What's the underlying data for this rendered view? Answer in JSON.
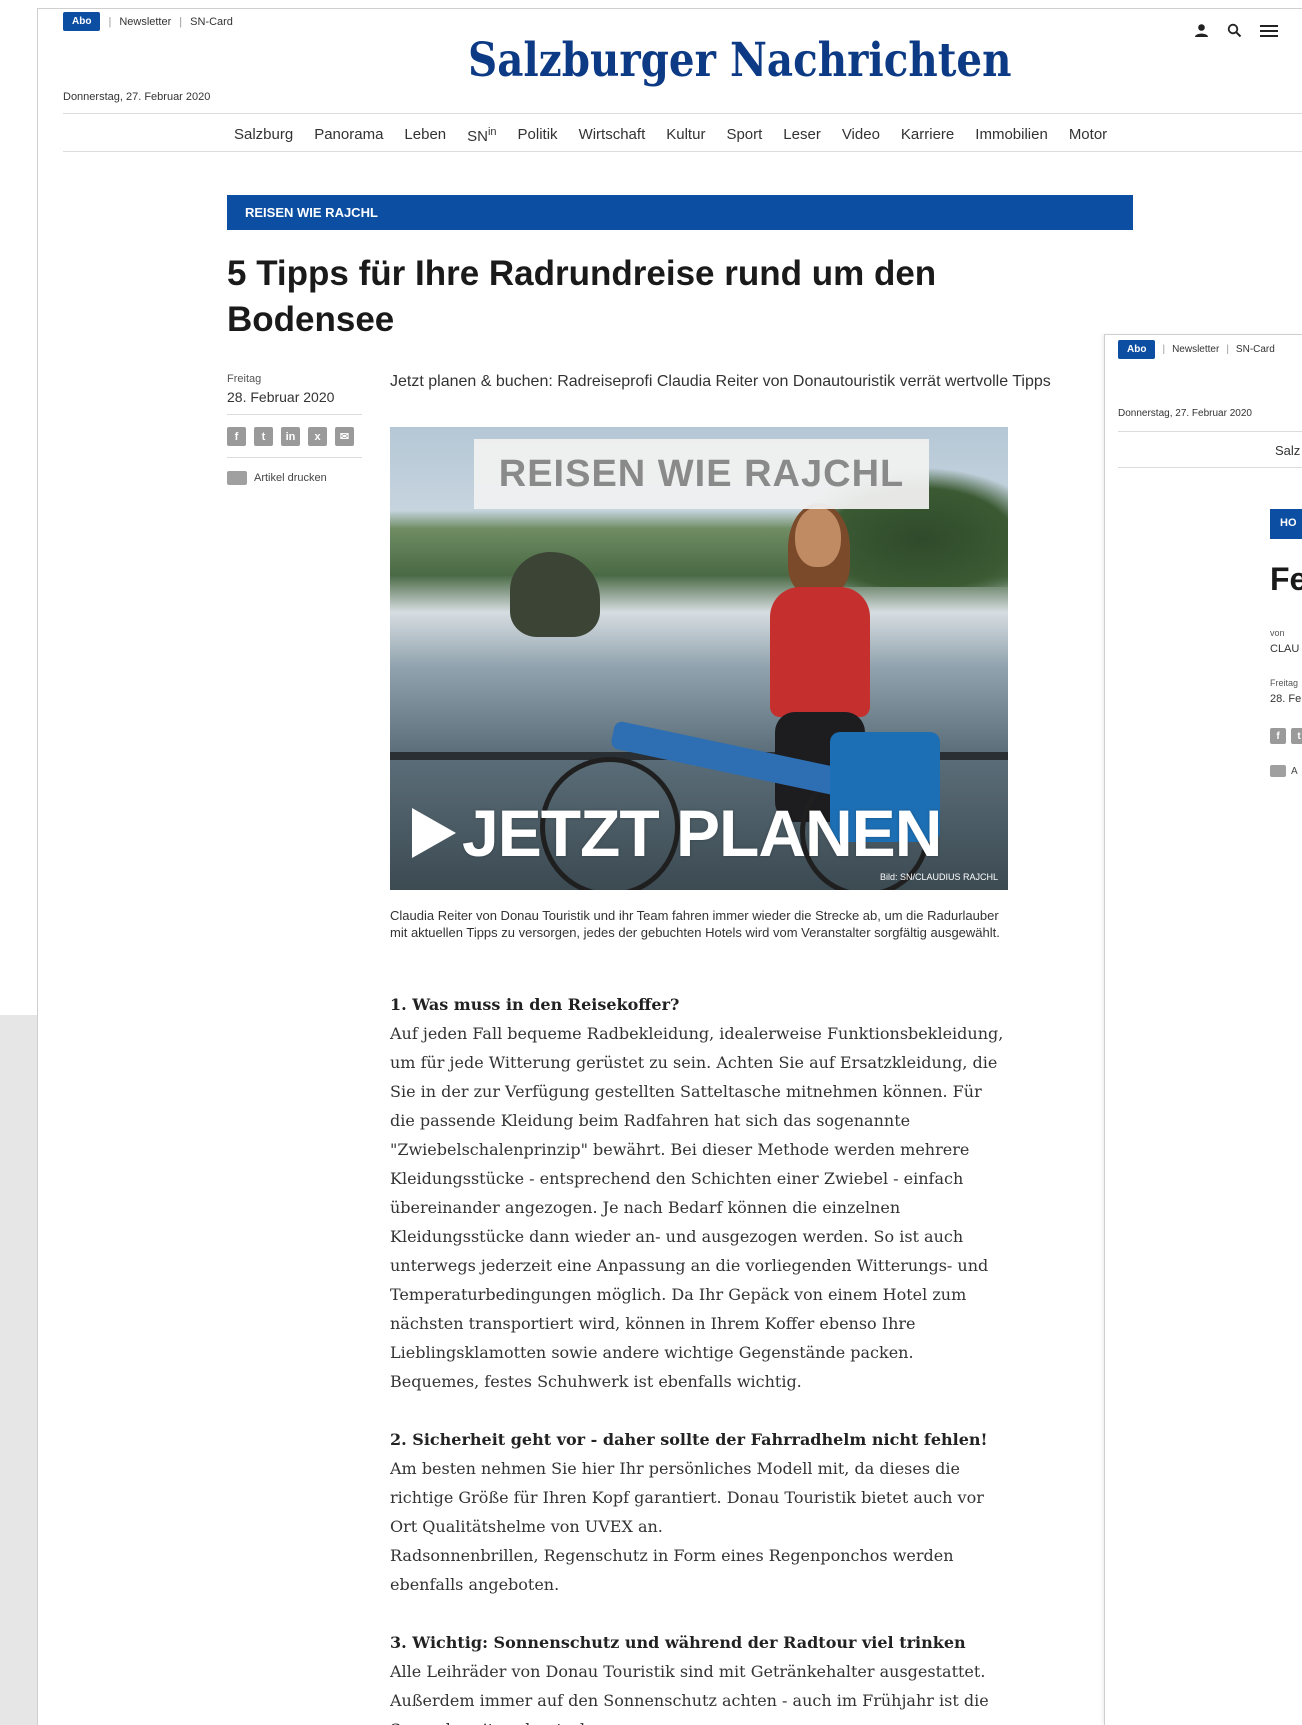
{
  "topbar": {
    "abo": "Abo",
    "newsletter": "Newsletter",
    "sncard": "SN-Card",
    "sep": "|"
  },
  "header": {
    "date": "Donnerstag, 27. Februar 2020",
    "logo": "Salzburger Nachrichten"
  },
  "nav": {
    "items": [
      "Salzburg",
      "Panorama",
      "Leben",
      "SN",
      "Politik",
      "Wirtschaft",
      "Kultur",
      "Sport",
      "Leser",
      "Video",
      "Karriere",
      "Immobilien",
      "Motor"
    ],
    "sn_sup": "in"
  },
  "article": {
    "kicker": "REISEN WIE RAJCHL",
    "headline": "5 Tipps für Ihre Radrundreise rund um den Bodensee",
    "meta_day": "Freitag",
    "meta_date": "28. Februar 2020",
    "share": [
      "f",
      "t",
      "in",
      "x",
      "✉"
    ],
    "print_label": "Artikel drucken",
    "lead": "Jetzt planen & buchen: Radreiseprofi Claudia Reiter von Donautouristik verrät wertvolle Tipps",
    "image": {
      "banner": "REISEN WIE RAJCHL",
      "cta": "JETZT PLANEN",
      "credit": "Bild: SN/CLAUDIUS RAJCHL"
    },
    "caption": "Claudia Reiter von Donau Touristik und ihr Team fahren immer wieder die Strecke ab, um die Radurlauber mit aktuellen Tipps zu versorgen, jedes der gebuchten Hotels wird vom Veranstalter sorgfältig ausgewählt.",
    "sections": [
      {
        "title": "1. Was muss in den Reisekoffer?",
        "text": "Auf jeden Fall bequeme Radbekleidung, idealerweise Funktionsbekleidung, um für jede Witterung gerüstet zu sein. Achten Sie auf Ersatzkleidung, die Sie in der zur Verfügung gestellten Satteltasche mitnehmen können. Für die passende Kleidung beim Radfahren hat sich das sogenannte \"Zwiebelschalenprinzip\" bewährt. Bei dieser Methode werden mehrere Kleidungsstücke - entsprechend den Schichten einer Zwiebel - einfach übereinander angezogen. Je nach Bedarf können die einzelnen Kleidungsstücke dann wieder an- und ausgezogen werden. So ist auch unterwegs jederzeit eine Anpassung an die vorliegenden Witterungs- und Temperaturbedingungen möglich. Da Ihr Gepäck von einem Hotel zum nächsten transportiert wird, können in Ihrem Koffer ebenso Ihre Lieblingsklamotten sowie andere wichtige Gegenstände packen.",
        "text2": "Bequemes, festes Schuhwerk ist ebenfalls wichtig."
      },
      {
        "title": "2. Sicherheit geht vor - daher sollte der Fahrradhelm nicht fehlen!",
        "text": "Am besten nehmen Sie hier Ihr persönliches Modell mit, da dieses die richtige Größe für Ihren Kopf garantiert. Donau Touristik bietet auch vor Ort Qualitätshelme von UVEX an.",
        "text2": "Radsonnenbrillen, Regenschutz in Form eines Regenponchos werden ebenfalls angeboten."
      },
      {
        "title": "3. Wichtig: Sonnenschutz und während der Radtour viel trinken",
        "text": "Alle Leihräder von Donau Touristik sind mit Getränkehalter ausgestattet. Außerdem immer auf den Sonnenschutz achten - auch im Frühjahr ist die Sonne bereits sehr stark."
      }
    ]
  },
  "page2": {
    "abo": "Abo",
    "newsletter": "Newsletter",
    "sncard": "SN-Card",
    "date": "Donnerstag, 27. Februar 2020",
    "nav": "Salz",
    "kicker": "HO",
    "headline": "Fe",
    "von": "von",
    "author": "CLAU",
    "day": "Freitag",
    "date2": "28. Fe",
    "print": "A"
  }
}
